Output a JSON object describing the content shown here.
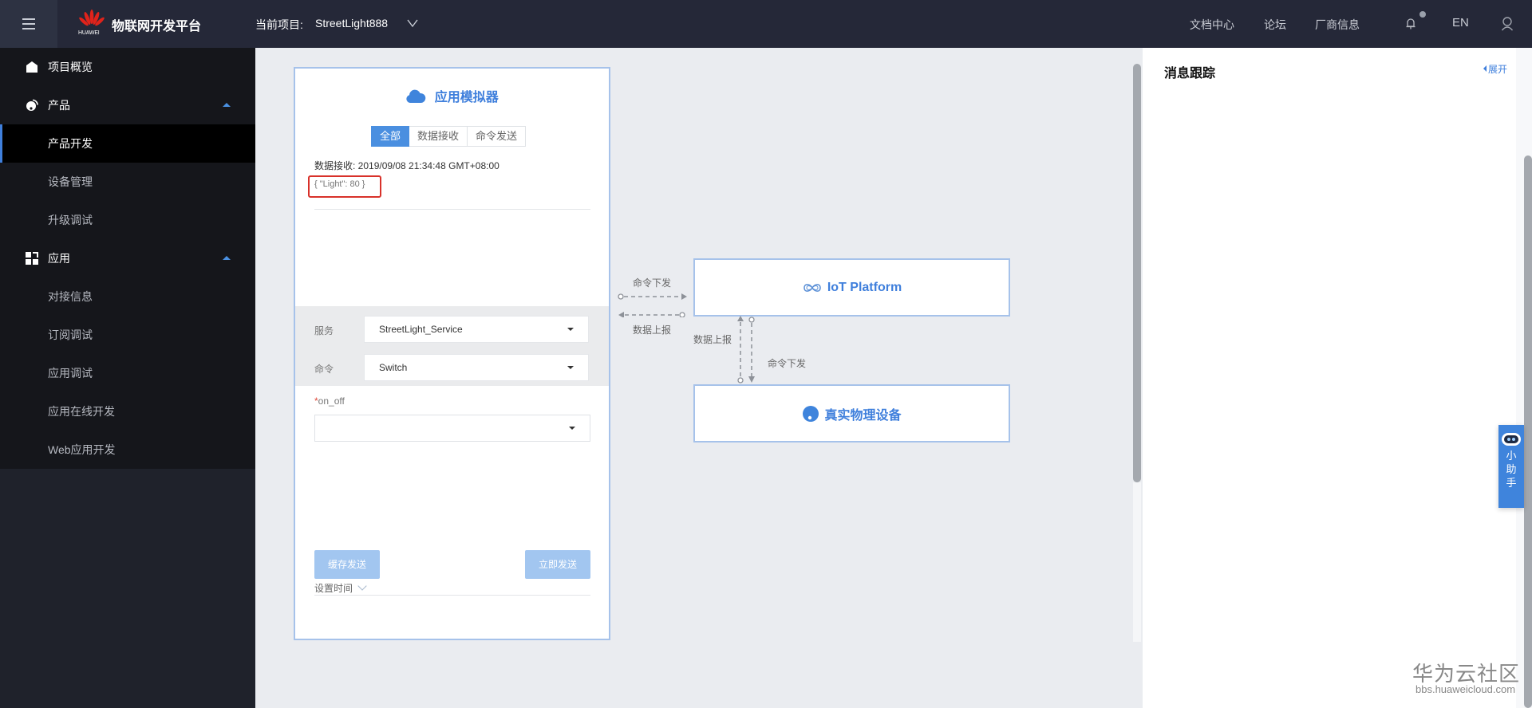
{
  "topbar": {
    "app_title": "物联网开发平台",
    "logo_text": "HUAWEI",
    "project_label": "当前项目:",
    "project_name": "StreetLight888",
    "links": [
      "文档中心",
      "论坛",
      "厂商信息"
    ],
    "lang": "EN",
    "icons": {
      "menu": "hamburger-icon",
      "chevron": "chevron-down-icon",
      "bell": "bell-icon",
      "user": "user-icon"
    }
  },
  "sidebar": {
    "groups": [
      {
        "label": "项目概览",
        "icon": "home-icon",
        "expanded": false,
        "items": []
      },
      {
        "label": "产品",
        "icon": "product-icon",
        "expanded": true,
        "items": [
          "产品开发",
          "设备管理",
          "升级调试"
        ]
      },
      {
        "label": "应用",
        "icon": "app-grid-icon",
        "expanded": true,
        "items": [
          "对接信息",
          "订阅调试",
          "应用调试",
          "应用在线开发",
          "Web应用开发"
        ]
      }
    ],
    "active_item": "产品开发"
  },
  "simulator": {
    "title": "应用模拟器",
    "tabs": [
      "全部",
      "数据接收",
      "命令发送"
    ],
    "active_tab": "全部",
    "message": {
      "header": "数据接收: 2019/09/08 21:34:48 GMT+08:00",
      "payload": "{ \"Light\": 80 }"
    },
    "form": {
      "service_label": "服务",
      "service_value": "StreetLight_Service",
      "command_label": "命令",
      "command_value": "Switch",
      "param_required_mark": "*",
      "param_label": "on_off",
      "param_value": ""
    },
    "buttons": {
      "cache_send": "缓存发送",
      "send_now": "立即发送"
    },
    "set_time": "设置时间"
  },
  "flow": {
    "cmd_down_top": "命令下发",
    "data_up_left": "数据上报",
    "data_up_vertical": "数据上报",
    "cmd_down_vertical": "命令下发",
    "platform_node": "IoT Platform",
    "device_node": "真实物理设备"
  },
  "message_panel": {
    "title": "消息跟踪",
    "expand": "展开"
  },
  "helper": {
    "label": [
      "小",
      "助",
      "手"
    ]
  },
  "watermark": {
    "title": "华为云社区",
    "url": "bbs.huaweicloud.com"
  },
  "colors": {
    "accent": "#3f7fdc",
    "topbar": "#252838",
    "sidebar": "#15161b",
    "alert": "#d8312a"
  }
}
